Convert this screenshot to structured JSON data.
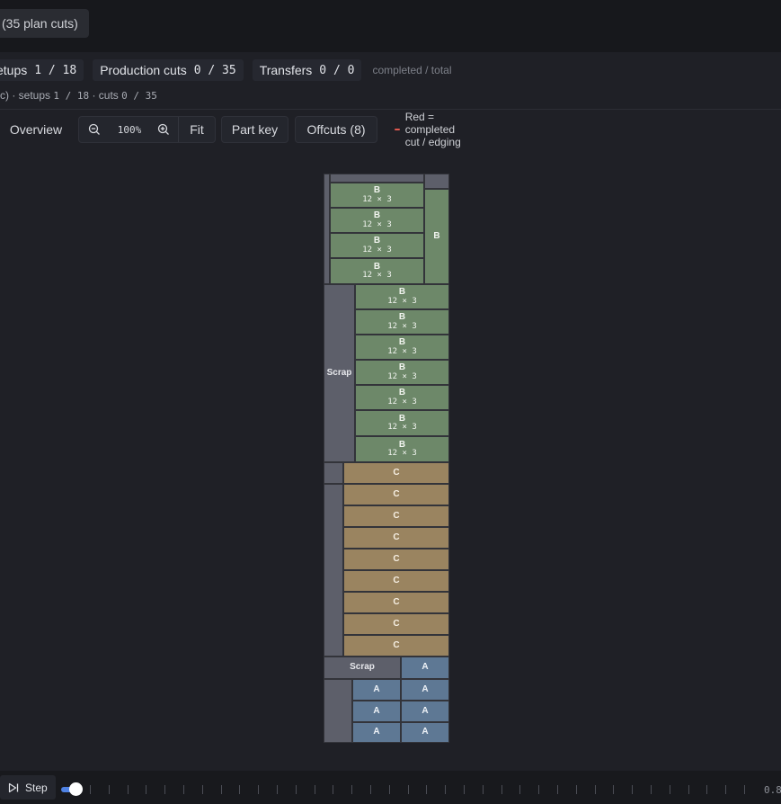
{
  "header": {
    "plan_label": "(35 plan cuts)"
  },
  "counters": [
    {
      "label": "etups",
      "value": "1 / 18"
    },
    {
      "label": "Production cuts",
      "value": "0 / 35"
    },
    {
      "label": "Transfers",
      "value": "0 / 0"
    }
  ],
  "counters_note": "completed / total",
  "subline": {
    "prefix": "c) · setups",
    "setups": "1 / 18",
    "middle": "· cuts",
    "cuts": "0 / 35"
  },
  "toolbar": {
    "overview": "Overview",
    "zoom_level": "100%",
    "fit": "Fit",
    "part_key": "Part key",
    "offcuts": "Offcuts (8)",
    "legend": "Red = completed cut / edging"
  },
  "sheet": {
    "parts": [
      {
        "label": "B",
        "dims": "12 × 3"
      },
      {
        "label": "B",
        "dims": "12 × 3"
      },
      {
        "label": "B",
        "dims": "12 × 3"
      },
      {
        "label": "B",
        "dims": "12 × 3"
      },
      {
        "label": "B",
        "dims": ""
      },
      {
        "label": "Scrap",
        "dims": ""
      },
      {
        "label": "B",
        "dims": "12 × 3"
      },
      {
        "label": "B",
        "dims": "12 × 3"
      },
      {
        "label": "B",
        "dims": "12 × 3"
      },
      {
        "label": "B",
        "dims": "12 × 3"
      },
      {
        "label": "B",
        "dims": "12 × 3"
      },
      {
        "label": "B",
        "dims": "12 × 3"
      },
      {
        "label": "B",
        "dims": "12 × 3"
      },
      {
        "label": "C",
        "dims": ""
      },
      {
        "label": "C",
        "dims": ""
      },
      {
        "label": "C",
        "dims": ""
      },
      {
        "label": "C",
        "dims": ""
      },
      {
        "label": "C",
        "dims": ""
      },
      {
        "label": "C",
        "dims": ""
      },
      {
        "label": "C",
        "dims": ""
      },
      {
        "label": "C",
        "dims": ""
      },
      {
        "label": "C",
        "dims": ""
      },
      {
        "label": "Scrap",
        "dims": ""
      },
      {
        "label": "A",
        "dims": ""
      },
      {
        "label": "A",
        "dims": ""
      },
      {
        "label": "A",
        "dims": ""
      },
      {
        "label": "A",
        "dims": ""
      },
      {
        "label": "A",
        "dims": ""
      },
      {
        "label": "A",
        "dims": ""
      },
      {
        "label": "A",
        "dims": ""
      }
    ]
  },
  "colors": {
    "part_b": "#6d8869",
    "part_c": "#9a8460",
    "part_a": "#5e7894",
    "scrap": "#5d5f6a",
    "completed_cut": "#e0584f",
    "slider": "#4f82e3"
  },
  "timeline": {
    "step_label": "Step",
    "end_label": "0.8",
    "progress": 0.02
  }
}
